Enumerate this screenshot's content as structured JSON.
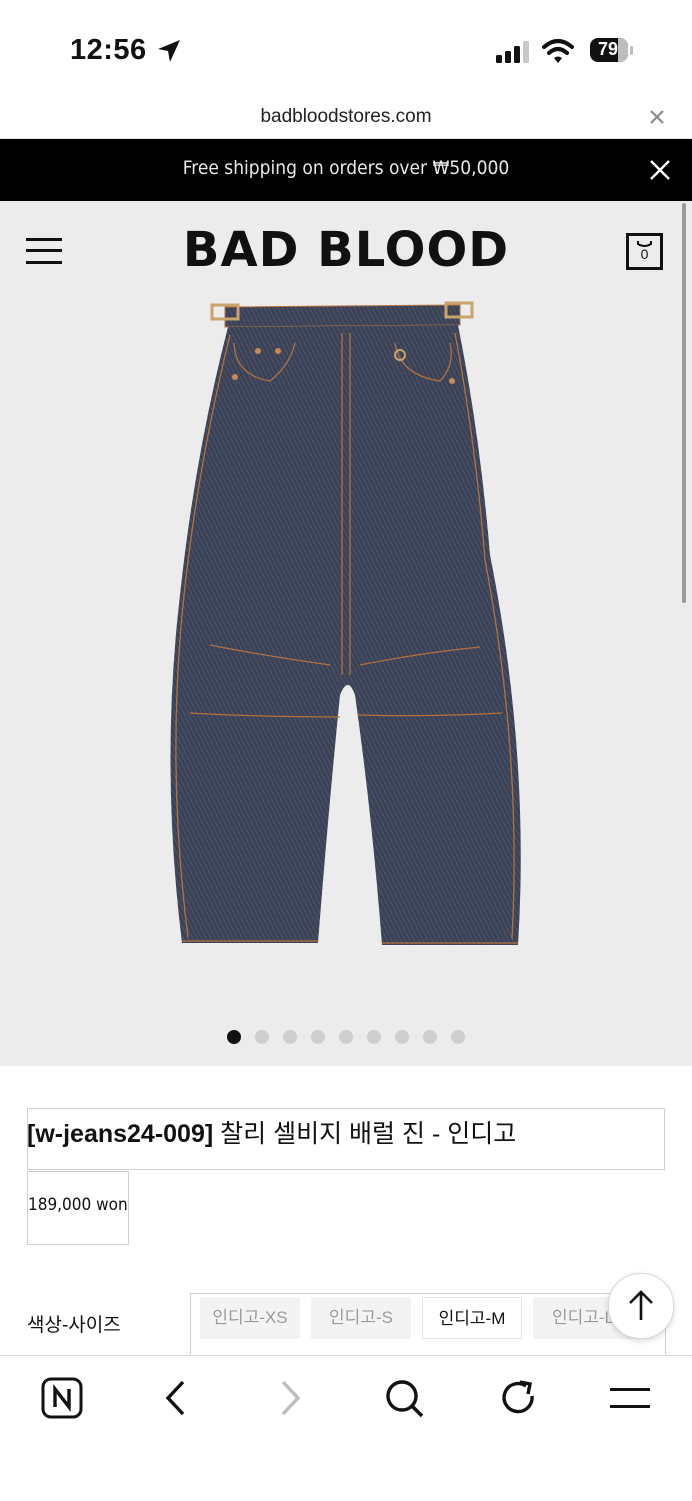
{
  "status_bar": {
    "time": "12:56",
    "battery": "79"
  },
  "browser": {
    "url": "badbloodstores.com"
  },
  "promo": {
    "text": "Free shipping on orders over ₩50,000"
  },
  "header": {
    "logo": "BAD BLOOD",
    "cart_count": "0"
  },
  "carousel": {
    "total": 9,
    "active_index": 0
  },
  "product": {
    "code": "[w-jeans24-009]",
    "name": "찰리 셀비지 배럴 진 - 인디고",
    "price": "189,000 won"
  },
  "options": {
    "label": "색상-사이즈",
    "items": [
      "인디고-XS",
      "인디고-S",
      "인디고-M",
      "인디고-L"
    ],
    "selected": "인디고-M"
  },
  "colors": {
    "promo_bg": "#000000",
    "hero_bg": "#ececec",
    "denim": "#3b4256",
    "stitch": "#b5713c"
  },
  "icons": [
    "location-arrow-icon",
    "signal-icon",
    "wifi-icon",
    "battery-icon",
    "close-icon",
    "menu-icon",
    "cart-icon",
    "arrow-up-icon",
    "naver-icon",
    "back-icon",
    "forward-icon",
    "search-icon",
    "refresh-icon",
    "browser-menu-icon"
  ]
}
